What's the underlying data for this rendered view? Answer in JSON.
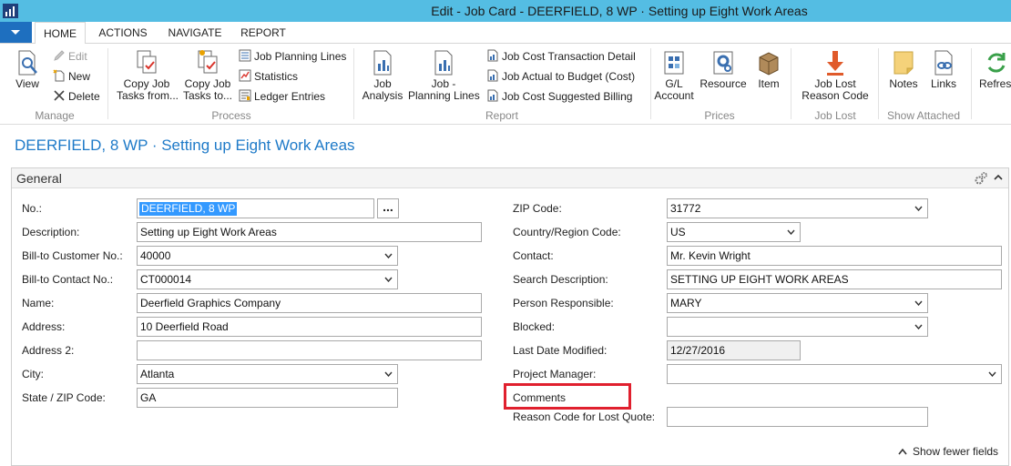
{
  "window": {
    "title": "Edit - Job Card - DEERFIELD, 8 WP · Setting up Eight Work Areas"
  },
  "tabs": [
    {
      "label": "HOME",
      "active": true
    },
    {
      "label": "ACTIONS",
      "active": false
    },
    {
      "label": "NAVIGATE",
      "active": false
    },
    {
      "label": "REPORT",
      "active": false
    }
  ],
  "ribbon": {
    "manage": {
      "label": "Manage",
      "view": "View",
      "edit": "Edit",
      "new": "New",
      "delete": "Delete"
    },
    "process": {
      "label": "Process",
      "copy_from_1": "Copy Job",
      "copy_from_2": "Tasks from...",
      "copy_to_1": "Copy Job",
      "copy_to_2": "Tasks to...",
      "job_planning_lines": "Job Planning Lines",
      "statistics": "Statistics",
      "ledger_entries": "Ledger Entries"
    },
    "report": {
      "label": "Report",
      "job_analysis_1": "Job",
      "job_analysis_2": "Analysis",
      "planning_1": "Job -",
      "planning_2": "Planning Lines",
      "cost_transaction_detail": "Job Cost Transaction Detail",
      "actual_to_budget": "Job Actual to Budget (Cost)",
      "suggested_billing": "Job Cost Suggested Billing"
    },
    "prices": {
      "label": "Prices",
      "gl_1": "G/L",
      "gl_2": "Account",
      "resource": "Resource",
      "item": "Item"
    },
    "job_lost": {
      "label": "Job Lost",
      "reason_1": "Job Lost",
      "reason_2": "Reason Code"
    },
    "show_attached": {
      "label": "Show Attached",
      "notes": "Notes",
      "links": "Links"
    },
    "refresh": "Refresh"
  },
  "page": {
    "title": "DEERFIELD, 8 WP · Setting up Eight Work Areas"
  },
  "general": {
    "title": "General",
    "left": [
      {
        "label": "No.:",
        "value": "DEERFIELD, 8 WP"
      },
      {
        "label": "Description:",
        "value": "Setting up Eight Work Areas"
      },
      {
        "label": "Bill-to Customer No.:",
        "value": "40000"
      },
      {
        "label": "Bill-to Contact No.:",
        "value": "CT000014"
      },
      {
        "label": "Name:",
        "value": "Deerfield Graphics Company"
      },
      {
        "label": "Address:",
        "value": "10 Deerfield Road"
      },
      {
        "label": "Address 2:",
        "value": ""
      },
      {
        "label": "City:",
        "value": "Atlanta"
      },
      {
        "label": "State / ZIP Code:",
        "value": "GA"
      }
    ],
    "right": [
      {
        "label": "ZIP Code:",
        "value": "31772"
      },
      {
        "label": "Country/Region Code:",
        "value": "US"
      },
      {
        "label": "Contact:",
        "value": "Mr. Kevin Wright"
      },
      {
        "label": "Search Description:",
        "value": "SETTING UP EIGHT WORK AREAS"
      },
      {
        "label": "Person Responsible:",
        "value": "MARY"
      },
      {
        "label": "Blocked:",
        "value": ""
      },
      {
        "label": "Last Date Modified:",
        "value": "12/27/2016"
      },
      {
        "label": "Project Manager:",
        "value": ""
      },
      {
        "label": "Comments",
        "value": ""
      },
      {
        "label": "Reason Code for Lost Quote:",
        "value": ""
      }
    ],
    "assist_button": "...",
    "show_fewer": "Show fewer fields"
  },
  "colors": {
    "titlebar": "#54bde3",
    "accent": "#1e7ac8",
    "highlight": "#e0202e"
  }
}
